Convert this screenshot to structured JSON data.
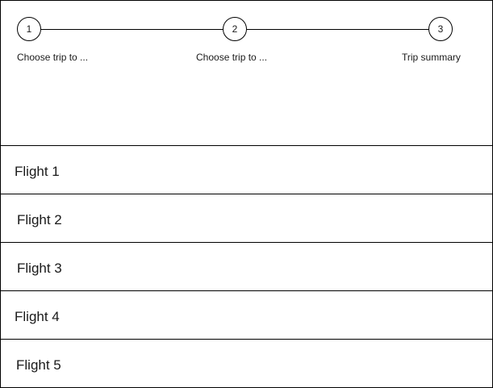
{
  "stepper": {
    "steps": [
      {
        "number": "1",
        "label": "Choose trip to ..."
      },
      {
        "number": "2",
        "label": "Choose trip to ..."
      },
      {
        "number": "3",
        "label": "Trip summary"
      }
    ]
  },
  "flights": [
    {
      "label": "Flight 1"
    },
    {
      "label": "Flight 2"
    },
    {
      "label": "Flight 3"
    },
    {
      "label": "Flight 4"
    },
    {
      "label": "Flight 5"
    }
  ]
}
